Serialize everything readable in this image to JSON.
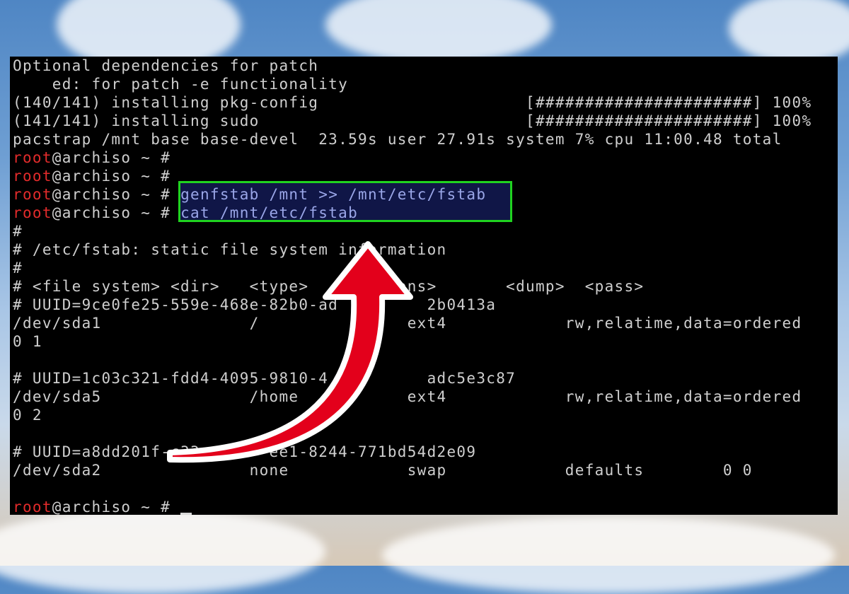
{
  "terminal": {
    "prompt_user": "root",
    "prompt_host": "@archiso ~ #",
    "lines": [
      "Optional dependencies for patch",
      "    ed: for patch -e functionality",
      "(140/141) installing pkg-config                     [######################] 100%",
      "(141/141) installing sudo                           [######################] 100%",
      "pacstrap /mnt base base-devel  23.59s user 27.91s system 7% cpu 11:00.48 total",
      "#",
      "# /etc/fstab: static file system information",
      "#",
      "# <file system> <dir>   <type>    <options>       <dump>  <pass>",
      "# UUID=9ce0fe25-559e-468e-82b0-ad         2b0413a",
      "/dev/sda1               /               ext4            rw,relatime,data=ordered",
      "0 1",
      "# UUID=1c03c321-fdd4-4095-9810-4          adc5e3c87",
      "/dev/sda5               /home           ext4            rw,relatime,data=ordered",
      "0 2",
      "# UUID=a8dd201f-c33       ee1-8244-771bd54d2e09",
      "/dev/sda2               none            swap            defaults        0 0"
    ],
    "commands": {
      "cmd1": "genfstab /mnt >> /mnt/etc/fstab",
      "cmd2": "cat /mnt/etc/fstab"
    }
  },
  "colors": {
    "terminal_bg": "#000000",
    "text": "#cfcfcf",
    "prompt_user": "#e22b2b",
    "highlight_border": "#20d320",
    "highlight_fill": "#161e5f",
    "arrow": "#e3001b"
  },
  "icons": [
    "curved-red-arrow-icon"
  ]
}
